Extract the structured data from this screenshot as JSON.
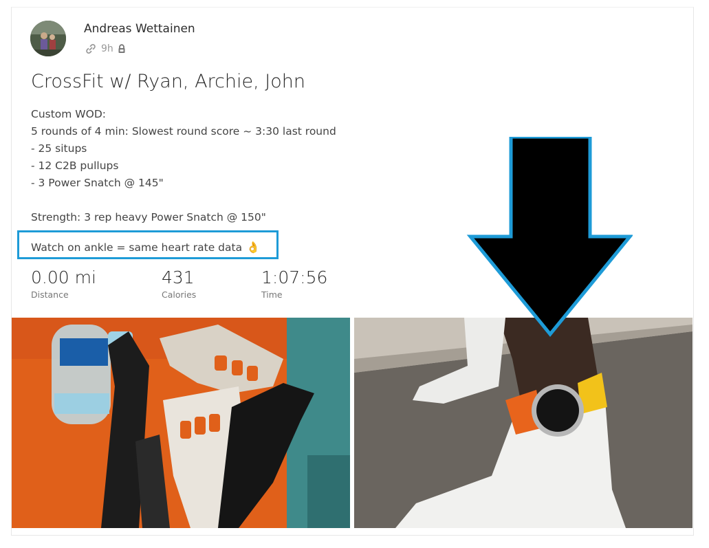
{
  "author": {
    "name": "Andreas Wettainen"
  },
  "meta": {
    "time": "9h",
    "link_icon": "link-icon",
    "lock_icon": "lock-icon"
  },
  "activity": {
    "title": "CrossFit w/ Ryan, Archie, John",
    "description_lines": [
      "Custom WOD:",
      "5 rounds of 4 min: Slowest round score ~ 3:30 last round",
      "- 25 situps",
      "- 12 C2B pullups",
      "- 3 Power Snatch @ 145\"",
      "",
      "Strength: 3 rep heavy Power Snatch @ 150\""
    ],
    "note": "Watch on ankle = same heart rate data",
    "note_emoji": "👌"
  },
  "stats": [
    {
      "value": "0.00 mi",
      "label": "Distance"
    },
    {
      "value": "431",
      "label": "Calories"
    },
    {
      "value": "1:07:56",
      "label": "Time"
    }
  ],
  "photos": [
    {
      "name": "photo-grips-and-water-bottle"
    },
    {
      "name": "photo-watch-on-ankle"
    }
  ],
  "colors": {
    "highlight_border": "#1e9bd7",
    "arrow_fill": "#000000",
    "arrow_stroke": "#1e9bd7"
  }
}
